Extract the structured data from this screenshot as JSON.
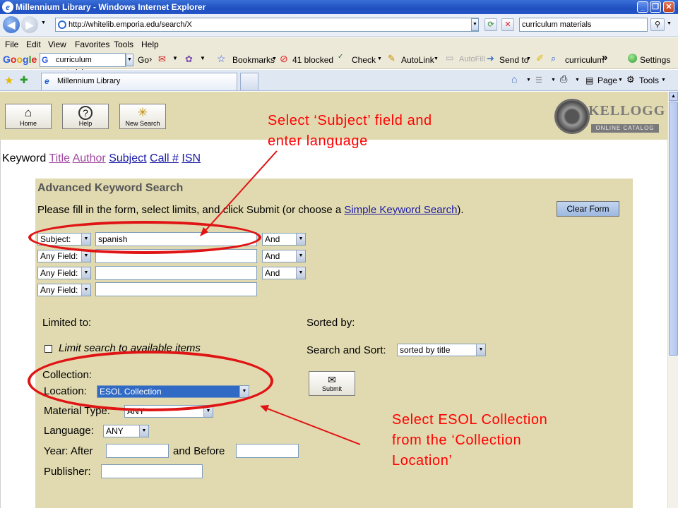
{
  "window": {
    "title": "Millennium Library - Windows Internet Explorer"
  },
  "address_bar": {
    "url": "http://whitelib.emporia.edu/search/X",
    "search_value": "curriculum materials"
  },
  "menu": [
    "File",
    "Edit",
    "View",
    "Favorites",
    "Tools",
    "Help"
  ],
  "google_toolbar": {
    "logo": "Google",
    "search_value": "curriculum materials",
    "go": "Go",
    "bookmarks": "Bookmarks",
    "blocked": "41 blocked",
    "check": "Check",
    "autolink": "AutoLink",
    "autofill": "AutoFill",
    "send_to": "Send to",
    "highlight_term": "curriculum",
    "more": "»",
    "settings": "Settings"
  },
  "tabs": {
    "active_tab": "Millennium Library",
    "tools": [
      "Page",
      "Tools"
    ]
  },
  "page_buttons": {
    "home": "Home",
    "help": "Help",
    "new_search": "New Search"
  },
  "logo": {
    "name": "KELLOGG",
    "subtitle": "ONLINE CATALOG"
  },
  "search_types": {
    "keyword": "Keyword",
    "links": [
      "Title",
      "Author",
      "Subject",
      "Call #",
      "ISN"
    ]
  },
  "form": {
    "title": "Advanced Keyword Search",
    "instruction_prefix": "Please fill in the form, select limits, and click Submit (or choose a ",
    "instruction_link": "Simple Keyword Search",
    "instruction_suffix": ").",
    "clear_button": "Clear Form",
    "rows": [
      {
        "field": "Subject:",
        "value": "spanish",
        "bool": "And"
      },
      {
        "field": "Any Field:",
        "value": "",
        "bool": "And"
      },
      {
        "field": "Any Field:",
        "value": "",
        "bool": "And"
      },
      {
        "field": "Any Field:",
        "value": "",
        "bool": null
      }
    ],
    "limited_to": "Limited to:",
    "limit_available": "Limit search to available items",
    "collection": "Collection:",
    "location_label": "Location:",
    "location_value": "ESOL Collection",
    "material_type_label": "Material Type:",
    "material_type_value": "ANY",
    "language_label": "Language:",
    "language_value": "ANY",
    "year_label": "Year: After",
    "year_and_before": "and Before",
    "publisher_label": "Publisher:",
    "sorted_by": "Sorted by:",
    "search_and_sort": "Search and Sort:",
    "sort_value": "sorted by title",
    "submit": "Submit"
  },
  "annotations": {
    "subject_note": [
      "Select ‘Subject’ field and",
      "enter language"
    ],
    "collection_note": [
      "Select ESOL Collection",
      "from the ‘Collection",
      "Location’"
    ]
  },
  "colors": {
    "annotation": "#ff0000",
    "panel": "#e1dab0",
    "title_bar": "#1f4fbf"
  }
}
